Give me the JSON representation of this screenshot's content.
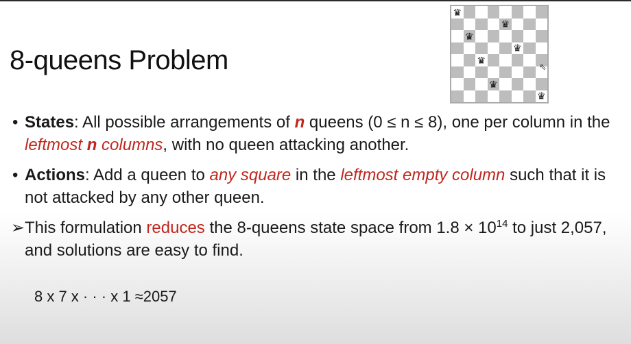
{
  "title": "8-queens Problem",
  "board": {
    "size": 8,
    "queen_glyph": "♛",
    "queens": [
      {
        "row": 0,
        "col": 0
      },
      {
        "row": 1,
        "col": 4
      },
      {
        "row": 2,
        "col": 1
      },
      {
        "row": 3,
        "col": 5
      },
      {
        "row": 4,
        "col": 2
      },
      {
        "row": 6,
        "col": 3
      },
      {
        "row": 7,
        "col": 7
      }
    ],
    "colors": {
      "light": "#ffffff",
      "dark": "#bdbdbd"
    }
  },
  "bullets": [
    {
      "mark": "•",
      "segments": [
        {
          "text": "States",
          "bold": true
        },
        {
          "text": ": All possible arrangements of "
        },
        {
          "text": "n",
          "bold": true,
          "italic": true,
          "red": true
        },
        {
          "text": " queens (0 ≤ n ≤ 8), one per column in the "
        },
        {
          "text": "leftmost ",
          "italic": true,
          "red": true
        },
        {
          "text": "n",
          "bold": true,
          "italic": true,
          "red": true
        },
        {
          "text": " columns",
          "italic": true,
          "red": true
        },
        {
          "text": ", with no queen attacking another."
        }
      ]
    },
    {
      "mark": "•",
      "segments": [
        {
          "text": "Actions",
          "bold": true
        },
        {
          "text": ": Add a queen to "
        },
        {
          "text": "any square",
          "italic": true,
          "red": true
        },
        {
          "text": " in the "
        },
        {
          "text": "leftmost empty column",
          "italic": true,
          "red": true
        },
        {
          "text": " such that it is not attacked by any other queen."
        }
      ]
    }
  ],
  "conclusion": {
    "mark": "➢",
    "before": "This formulation ",
    "highlight": "reduces",
    "middle": " the 8-queens state space from 1.8 × 10",
    "exponent": "14",
    "after": " to just 2,057, and solutions are easy to find."
  },
  "equation": "8 x 7 x · · · x 1 ≈2057",
  "colors": {
    "accent_red": "#c0271e",
    "text": "#1a1a1a"
  }
}
